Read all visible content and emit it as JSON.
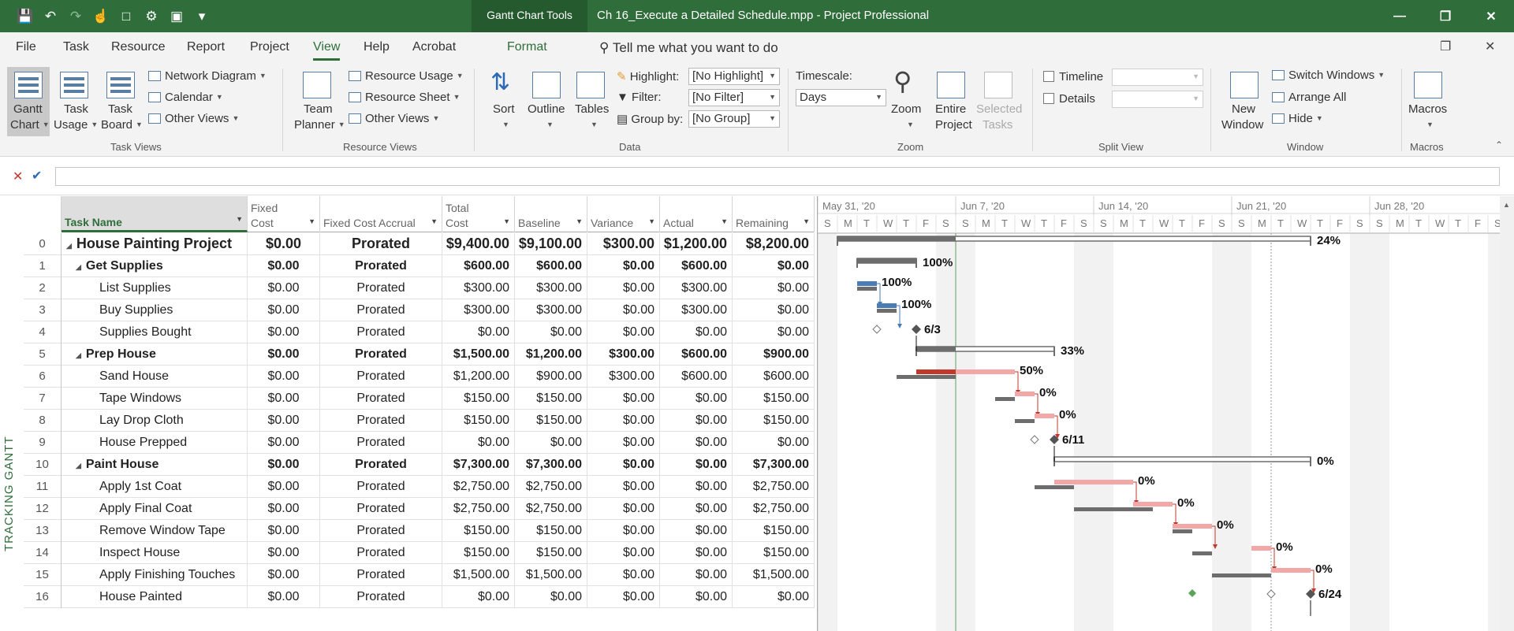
{
  "titlebar": {
    "context_tab": "Gantt Chart Tools",
    "document_title": "Ch 16_Execute a Detailed Schedule.mpp  -  Project Professional"
  },
  "ribbon_tabs": [
    "File",
    "Task",
    "Resource",
    "Report",
    "Project",
    "View",
    "Help",
    "Acrobat",
    "Format"
  ],
  "active_tab": "View",
  "tell_me": "Tell me what you want to do",
  "ribbon": {
    "task_views": {
      "gantt_chart": [
        "Gantt",
        "Chart"
      ],
      "task_usage": [
        "Task",
        "Usage"
      ],
      "task_board": [
        "Task",
        "Board"
      ],
      "network_diagram": "Network Diagram",
      "calendar": "Calendar",
      "other_views": "Other Views",
      "label": "Task Views"
    },
    "resource_views": {
      "team_planner": [
        "Team",
        "Planner"
      ],
      "resource_usage": "Resource Usage",
      "resource_sheet": "Resource Sheet",
      "other_views": "Other Views",
      "label": "Resource Views"
    },
    "data": {
      "sort": "Sort",
      "outline": "Outline",
      "tables": "Tables",
      "highlight_label": "Highlight:",
      "highlight_value": "[No Highlight]",
      "filter_label": "Filter:",
      "filter_value": "[No Filter]",
      "groupby_label": "Group by:",
      "groupby_value": "[No Group]",
      "label": "Data"
    },
    "zoom": {
      "timescale_label": "Timescale:",
      "timescale_value": "Days",
      "zoom": "Zoom",
      "entire_project": [
        "Entire",
        "Project"
      ],
      "selected_tasks": [
        "Selected",
        "Tasks"
      ],
      "label": "Zoom"
    },
    "split_view": {
      "timeline": "Timeline",
      "details": "Details",
      "label": "Split View"
    },
    "window": {
      "new_window": [
        "New",
        "Window"
      ],
      "switch_windows": "Switch Windows",
      "arrange_all": "Arrange All",
      "hide": "Hide",
      "label": "Window"
    },
    "macros": {
      "macros": "Macros",
      "label": "Macros"
    }
  },
  "view_label": "TRACKING GANTT",
  "columns": [
    {
      "label": "",
      "key": "id"
    },
    {
      "label": "Task Name",
      "key": "name"
    },
    {
      "label": "Fixed\nCost",
      "key": "fixed_cost"
    },
    {
      "label": "Fixed Cost Accrual",
      "key": "accrual"
    },
    {
      "label": "Total\nCost",
      "key": "total"
    },
    {
      "label": "Baseline",
      "key": "baseline"
    },
    {
      "label": "Variance",
      "key": "variance"
    },
    {
      "label": "Actual",
      "key": "actual"
    },
    {
      "label": "Remaining",
      "key": "remaining"
    }
  ],
  "tasks": [
    {
      "id": "0",
      "name": "House Painting Project",
      "level": 0,
      "summary": true,
      "fixed_cost": "$0.00",
      "accrual": "Prorated",
      "total": "$9,400.00",
      "baseline": "$9,100.00",
      "variance": "$300.00",
      "actual": "$1,200.00",
      "remaining": "$8,200.00"
    },
    {
      "id": "1",
      "name": "Get Supplies",
      "level": 1,
      "summary": true,
      "fixed_cost": "$0.00",
      "accrual": "Prorated",
      "total": "$600.00",
      "baseline": "$600.00",
      "variance": "$0.00",
      "actual": "$600.00",
      "remaining": "$0.00"
    },
    {
      "id": "2",
      "name": "List Supplies",
      "level": 2,
      "summary": false,
      "fixed_cost": "$0.00",
      "accrual": "Prorated",
      "total": "$300.00",
      "baseline": "$300.00",
      "variance": "$0.00",
      "actual": "$300.00",
      "remaining": "$0.00"
    },
    {
      "id": "3",
      "name": "Buy Supplies",
      "level": 2,
      "summary": false,
      "fixed_cost": "$0.00",
      "accrual": "Prorated",
      "total": "$300.00",
      "baseline": "$300.00",
      "variance": "$0.00",
      "actual": "$300.00",
      "remaining": "$0.00"
    },
    {
      "id": "4",
      "name": "Supplies Bought",
      "level": 2,
      "summary": false,
      "fixed_cost": "$0.00",
      "accrual": "Prorated",
      "total": "$0.00",
      "baseline": "$0.00",
      "variance": "$0.00",
      "actual": "$0.00",
      "remaining": "$0.00"
    },
    {
      "id": "5",
      "name": "Prep House",
      "level": 1,
      "summary": true,
      "fixed_cost": "$0.00",
      "accrual": "Prorated",
      "total": "$1,500.00",
      "baseline": "$1,200.00",
      "variance": "$300.00",
      "actual": "$600.00",
      "remaining": "$900.00"
    },
    {
      "id": "6",
      "name": "Sand House",
      "level": 2,
      "summary": false,
      "fixed_cost": "$0.00",
      "accrual": "Prorated",
      "total": "$1,200.00",
      "baseline": "$900.00",
      "variance": "$300.00",
      "actual": "$600.00",
      "remaining": "$600.00"
    },
    {
      "id": "7",
      "name": "Tape Windows",
      "level": 2,
      "summary": false,
      "fixed_cost": "$0.00",
      "accrual": "Prorated",
      "total": "$150.00",
      "baseline": "$150.00",
      "variance": "$0.00",
      "actual": "$0.00",
      "remaining": "$150.00"
    },
    {
      "id": "8",
      "name": "Lay Drop Cloth",
      "level": 2,
      "summary": false,
      "fixed_cost": "$0.00",
      "accrual": "Prorated",
      "total": "$150.00",
      "baseline": "$150.00",
      "variance": "$0.00",
      "actual": "$0.00",
      "remaining": "$150.00"
    },
    {
      "id": "9",
      "name": "House Prepped",
      "level": 2,
      "summary": false,
      "fixed_cost": "$0.00",
      "accrual": "Prorated",
      "total": "$0.00",
      "baseline": "$0.00",
      "variance": "$0.00",
      "actual": "$0.00",
      "remaining": "$0.00"
    },
    {
      "id": "10",
      "name": "Paint House",
      "level": 1,
      "summary": true,
      "fixed_cost": "$0.00",
      "accrual": "Prorated",
      "total": "$7,300.00",
      "baseline": "$7,300.00",
      "variance": "$0.00",
      "actual": "$0.00",
      "remaining": "$7,300.00"
    },
    {
      "id": "11",
      "name": "Apply 1st Coat",
      "level": 2,
      "summary": false,
      "fixed_cost": "$0.00",
      "accrual": "Prorated",
      "total": "$2,750.00",
      "baseline": "$2,750.00",
      "variance": "$0.00",
      "actual": "$0.00",
      "remaining": "$2,750.00"
    },
    {
      "id": "12",
      "name": "Apply Final Coat",
      "level": 2,
      "summary": false,
      "fixed_cost": "$0.00",
      "accrual": "Prorated",
      "total": "$2,750.00",
      "baseline": "$2,750.00",
      "variance": "$0.00",
      "actual": "$0.00",
      "remaining": "$2,750.00"
    },
    {
      "id": "13",
      "name": "Remove Window Tape",
      "level": 2,
      "summary": false,
      "fixed_cost": "$0.00",
      "accrual": "Prorated",
      "total": "$150.00",
      "baseline": "$150.00",
      "variance": "$0.00",
      "actual": "$0.00",
      "remaining": "$150.00"
    },
    {
      "id": "14",
      "name": "Inspect House",
      "level": 2,
      "summary": false,
      "fixed_cost": "$0.00",
      "accrual": "Prorated",
      "total": "$150.00",
      "baseline": "$150.00",
      "variance": "$0.00",
      "actual": "$0.00",
      "remaining": "$150.00"
    },
    {
      "id": "15",
      "name": "Apply Finishing Touches",
      "level": 2,
      "summary": false,
      "fixed_cost": "$0.00",
      "accrual": "Prorated",
      "total": "$1,500.00",
      "baseline": "$1,500.00",
      "variance": "$0.00",
      "actual": "$0.00",
      "remaining": "$1,500.00"
    },
    {
      "id": "16",
      "name": "House Painted",
      "level": 2,
      "summary": false,
      "fixed_cost": "$0.00",
      "accrual": "Prorated",
      "total": "$0.00",
      "baseline": "$0.00",
      "variance": "$0.00",
      "actual": "$0.00",
      "remaining": "$0.00"
    }
  ],
  "timescale": {
    "weeks": [
      "May 31, '20",
      "Jun 7, '20",
      "Jun 14, '20",
      "Jun 21, '20",
      "Jun 28, '20"
    ],
    "day_letters": [
      "S",
      "M",
      "T",
      "W",
      "T",
      "F",
      "S"
    ]
  },
  "gantt": {
    "bars": [
      {
        "row": 0,
        "type": "summary",
        "start": 0,
        "end": 24,
        "percent": "24%"
      },
      {
        "row": 1,
        "type": "summary",
        "start": 1,
        "end": 4,
        "percent": "100%"
      },
      {
        "row": 2,
        "type": "task",
        "start": 1,
        "end": 2,
        "done": 1,
        "percent": "100%",
        "baseline": [
          1,
          2
        ]
      },
      {
        "row": 3,
        "type": "task",
        "start": 2,
        "end": 3,
        "done": 1,
        "percent": "100%",
        "baseline": [
          2,
          3
        ]
      },
      {
        "row": 4,
        "type": "milestone",
        "at": 4,
        "label": "6/3",
        "baseline_at": 2
      },
      {
        "row": 5,
        "type": "summary",
        "start": 4,
        "end": 11,
        "percent": "33%"
      },
      {
        "row": 6,
        "type": "task",
        "start": 4,
        "end": 9,
        "done": 0.4,
        "percent": "50%",
        "baseline": [
          3,
          6
        ]
      },
      {
        "row": 7,
        "type": "task",
        "start": 9,
        "end": 10,
        "done": 0,
        "percent": "0%",
        "baseline": [
          8,
          9
        ]
      },
      {
        "row": 8,
        "type": "task",
        "start": 10,
        "end": 11,
        "done": 0,
        "percent": "0%",
        "baseline": [
          9,
          10
        ]
      },
      {
        "row": 9,
        "type": "milestone",
        "at": 11,
        "label": "6/11",
        "baseline_at": 10
      },
      {
        "row": 10,
        "type": "summary",
        "start": 11,
        "end": 24,
        "percent": "0%"
      },
      {
        "row": 11,
        "type": "task",
        "start": 11,
        "end": 15,
        "done": 0,
        "percent": "0%",
        "baseline": [
          10,
          12
        ]
      },
      {
        "row": 12,
        "type": "task",
        "start": 15,
        "end": 17,
        "done": 0,
        "percent": "0%",
        "baseline": [
          12,
          16
        ]
      },
      {
        "row": 13,
        "type": "task",
        "start": 17,
        "end": 19,
        "done": 0,
        "percent": "0%",
        "baseline": [
          17,
          18
        ]
      },
      {
        "row": 14,
        "type": "task",
        "start": 21,
        "end": 22,
        "done": 0,
        "percent": "0%",
        "baseline": [
          18,
          19
        ]
      },
      {
        "row": 15,
        "type": "task",
        "start": 22,
        "end": 24,
        "done": 0,
        "percent": "0%",
        "baseline": [
          19,
          22
        ]
      },
      {
        "row": 16,
        "type": "milestone",
        "at": 24,
        "label": "6/24",
        "baseline_at": 22
      }
    ]
  },
  "colors": {
    "brand": "#2f6e3a",
    "actual": "#4a7cb5",
    "remaining_crit": "#f3a7a7",
    "progress_crit": "#c0392b",
    "baseline": "#6d6d6d",
    "link_crit": "#c0392b",
    "link": "#4a7cb5",
    "summary": "#6d6d6d"
  }
}
